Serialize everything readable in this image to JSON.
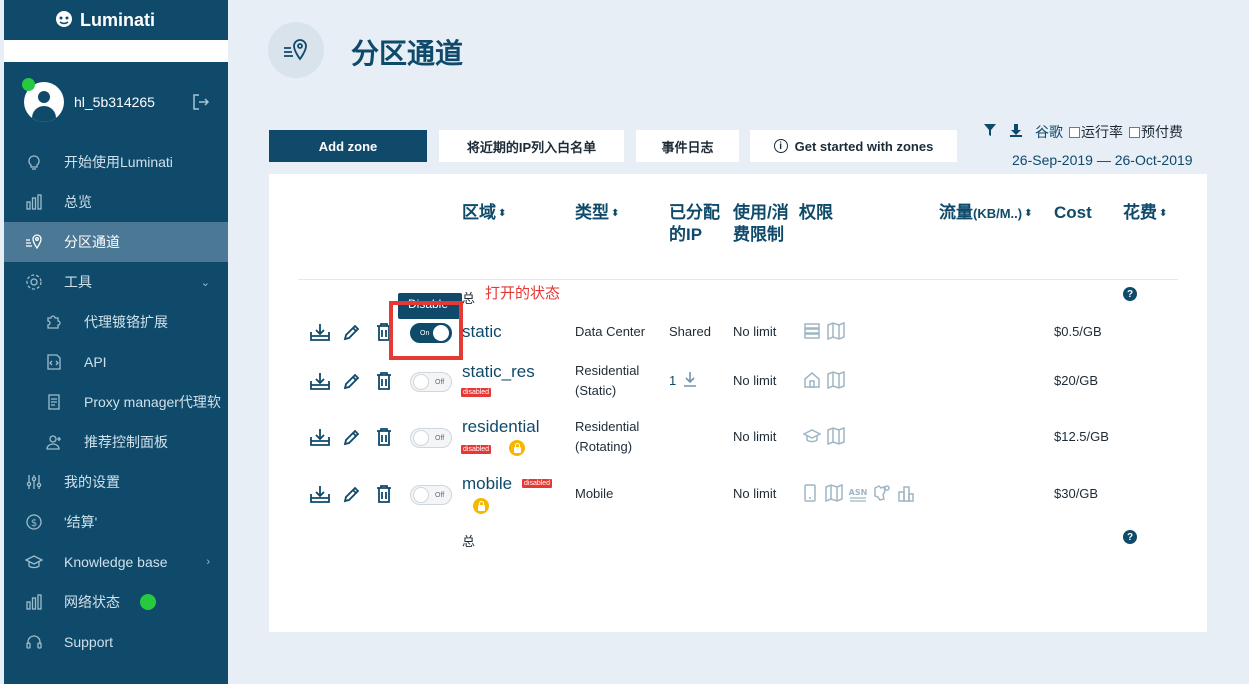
{
  "sidebar": {
    "logo": "Luminati",
    "user": {
      "name": "hl_5b314265"
    },
    "items": [
      {
        "label": "开始使用Luminati"
      },
      {
        "label": "总览"
      },
      {
        "label": "分区通道"
      },
      {
        "label": "工具"
      },
      {
        "label": "代理镀铬扩展"
      },
      {
        "label": "API"
      },
      {
        "label": "Proxy manager代理软"
      },
      {
        "label": "推荐控制面板"
      },
      {
        "label": "我的设置"
      },
      {
        "label": "'结算'"
      },
      {
        "label": "Knowledge base"
      },
      {
        "label": "网络状态"
      },
      {
        "label": "Support"
      }
    ]
  },
  "header": {
    "title": "分区通道"
  },
  "actions": {
    "add_zone": "Add zone",
    "whitelist": "将近期的IP列入白名单",
    "event_log": "事件日志",
    "get_started": "Get started with zones"
  },
  "toolbar": {
    "google": "谷歌",
    "uptime": "运行率",
    "prepaid": "预付费",
    "date_range": "26-Sep-2019 — 26-Oct-2019"
  },
  "table": {
    "headers": {
      "zone": "区域",
      "type": "类型",
      "allocated": "已分配的IP",
      "usage": "使用/消费限制",
      "permissions": "权限",
      "traffic": "流量",
      "traffic_unit": "(KB/M..)",
      "cost": "Cost",
      "spend": "花费"
    },
    "total_label": "总",
    "annotation": "打开的状态",
    "tooltip": "Disable",
    "toggle_on": "On",
    "toggle_off": "Off",
    "disabled_badge": "disabled",
    "rows": [
      {
        "name": "static",
        "type_line1": "Data Center",
        "type_line2": "",
        "allocated": "Shared",
        "limit": "No limit",
        "cost": "$0.5/GB",
        "state": "On"
      },
      {
        "name": "static_res",
        "type_line1": "Residential",
        "type_line2": "(Static)",
        "allocated": "1",
        "limit": "No limit",
        "cost": "$20/GB",
        "state": "Off"
      },
      {
        "name": "residential",
        "type_line1": "Residential",
        "type_line2": "(Rotating)",
        "allocated": "",
        "limit": "No limit",
        "cost": "$12.5/GB",
        "state": "Off"
      },
      {
        "name": "mobile",
        "type_line1": "Mobile",
        "type_line2": "",
        "allocated": "",
        "limit": "No limit",
        "cost": "$30/GB",
        "state": "Off"
      }
    ]
  },
  "colors": {
    "brand": "#0f4a6b",
    "sidebar_active": "#4b7895",
    "online": "#27c93f",
    "alert": "#e53935",
    "lock": "#f5b700"
  }
}
